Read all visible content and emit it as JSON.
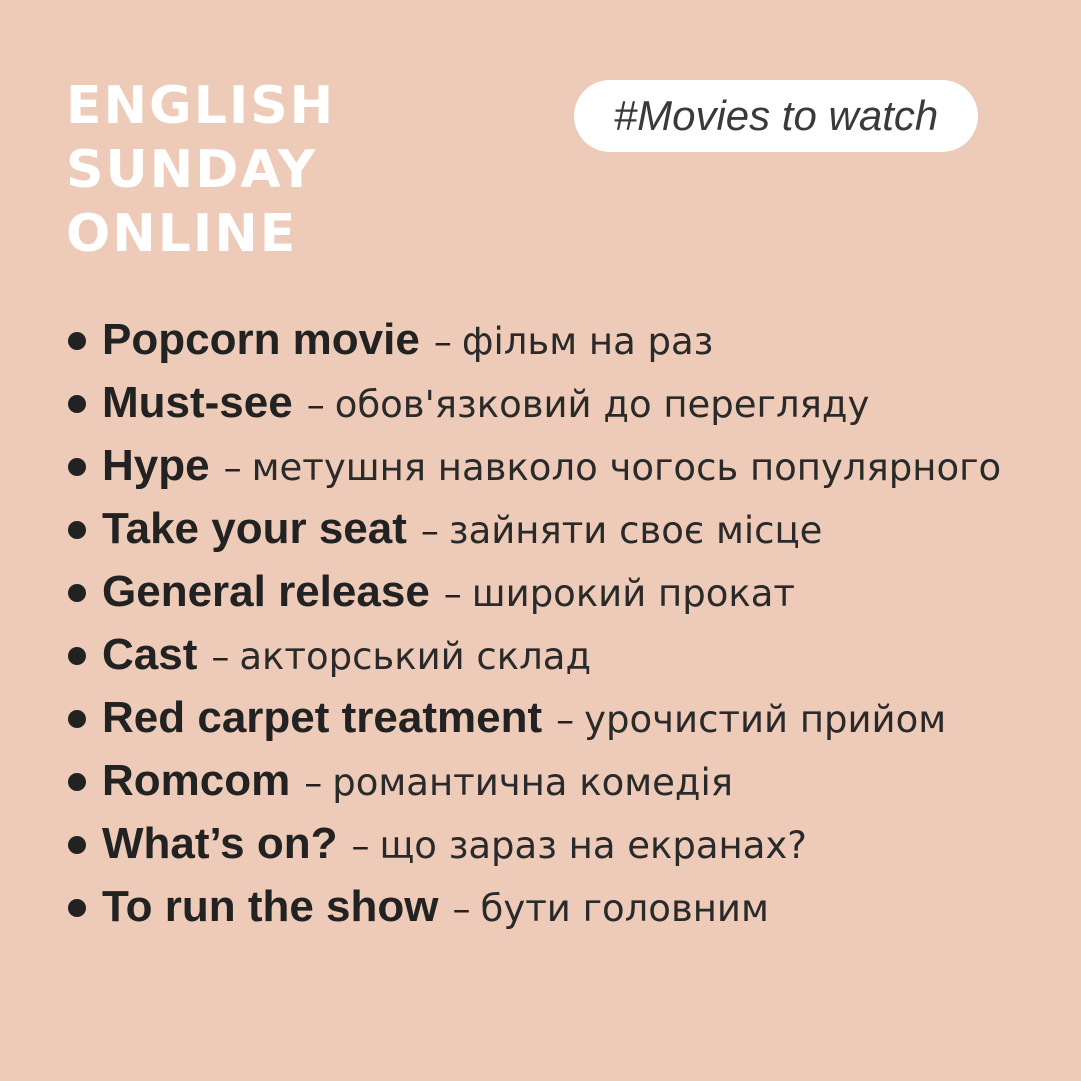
{
  "header": {
    "brand_lines": [
      "ENGLISH",
      "SUNDAY",
      "ONLINE"
    ],
    "hashtag": "#Movies to watch"
  },
  "vocabulary": [
    {
      "term": "Popcorn movie",
      "dash": "–",
      "translation": "фільм на раз"
    },
    {
      "term": "Must-see",
      "dash": "–",
      "translation": "обов'язковий до перегляду"
    },
    {
      "term": "Hype",
      "dash": "–",
      "translation": "метушня навколо чогось популярного"
    },
    {
      "term": "Take your seat",
      "dash": "–",
      "translation": "зайняти своє місце"
    },
    {
      "term": "General release",
      "dash": "–",
      "translation": "широкий прокат"
    },
    {
      "term": "Cast",
      "dash": "–",
      "translation": "акторський склад"
    },
    {
      "term": "Red carpet treatment",
      "dash": "–",
      "translation": "урочистий прийом"
    },
    {
      "term": "Romcom",
      "dash": "–",
      "translation": "романтична комедія"
    },
    {
      "term": "What’s on?",
      "dash": "–",
      "translation": "що зараз на екранах?"
    },
    {
      "term": "To run the show",
      "dash": "–",
      "translation": "бути головним"
    }
  ],
  "colors": {
    "background": "#EDCBB8",
    "brand_text": "#FFFFFF",
    "pill_background": "#FFFFFF",
    "body_text": "#222222"
  },
  "icons": {
    "bullet": "bullet-dot-icon"
  }
}
